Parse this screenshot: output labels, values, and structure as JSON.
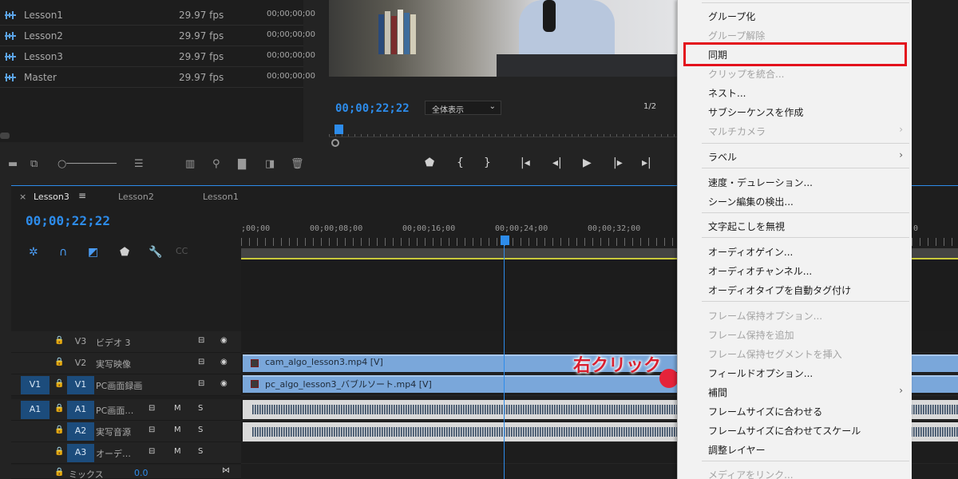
{
  "project": {
    "sequences": [
      {
        "name": "Lesson1",
        "fps": "29.97 fps",
        "tc": "00;00;00;00"
      },
      {
        "name": "Lesson2",
        "fps": "29.97 fps",
        "tc": "00;00;00;00"
      },
      {
        "name": "Lesson3",
        "fps": "29.97 fps",
        "tc": "00;00;00;00"
      },
      {
        "name": "Master",
        "fps": "29.97 fps",
        "tc": "00;00;00;00"
      }
    ]
  },
  "program": {
    "timecode": "00;00;22;22",
    "zoom": "全体表示",
    "resolution": "1/2"
  },
  "timeline": {
    "tab_close": "×",
    "tab_active": "Lesson3",
    "tab_menu": "≡",
    "tab_2": "Lesson2",
    "tab_1": "Lesson1",
    "timecode": "00;00;22;22",
    "ruler": [
      ";00;00",
      "00;00;08;00",
      "00;00;16;00",
      "00;00;24;00",
      "00;00;32;00",
      "0"
    ],
    "tracks": {
      "v3": {
        "target": "V3",
        "name": "ビデオ 3"
      },
      "v2": {
        "target": "V2",
        "name": "実写映像"
      },
      "v1": {
        "source": "V1",
        "target": "V1",
        "name": "PC画面録画"
      },
      "a1": {
        "source": "A1",
        "target": "A1",
        "name": "PC画面…"
      },
      "a2": {
        "target": "A2",
        "name": "実写音源"
      },
      "a3": {
        "target": "A3",
        "name": "オーデ…"
      },
      "mix": {
        "name": "ミックス",
        "value": "0.0"
      }
    },
    "mute_label": "M",
    "solo_label": "S",
    "clips": {
      "v2_clip": "cam_algo_lesson3.mp4 [V]",
      "v1_clip": "pc_algo_lesson3_バブルソート.mp4 [V]"
    }
  },
  "annotation": "右クリック",
  "context_menu": {
    "items_top": [
      {
        "label": "グループ化",
        "disabled": false
      },
      {
        "label": "グループ解除",
        "disabled": true
      },
      {
        "label": "同期",
        "disabled": false
      },
      {
        "label": "クリップを統合...",
        "disabled": true
      },
      {
        "label": "ネスト...",
        "disabled": false
      },
      {
        "label": "サブシーケンスを作成",
        "disabled": false
      },
      {
        "label": "マルチカメラ",
        "disabled": true
      }
    ],
    "label_item": "ラベル",
    "items_speed": [
      "速度・デュレーション...",
      "シーン編集の検出..."
    ],
    "transcribe": "文字起こしを無視",
    "items_audio": [
      "オーディオゲイン...",
      "オーディオチャンネル...",
      "オーディオタイプを自動タグ付け"
    ],
    "items_frame": [
      {
        "label": "フレーム保持オプション...",
        "disabled": true
      },
      {
        "label": "フレーム保持を追加",
        "disabled": true
      },
      {
        "label": "フレーム保持セグメントを挿入",
        "disabled": true
      },
      {
        "label": "フィールドオプション...",
        "disabled": false
      },
      {
        "label": "補間",
        "disabled": false
      },
      {
        "label": "フレームサイズに合わせる",
        "disabled": false
      },
      {
        "label": "フレームサイズに合わせてスケール",
        "disabled": false
      },
      {
        "label": "調整レイヤー",
        "disabled": false
      }
    ],
    "relink": "メディアをリンク..."
  },
  "colors": {
    "accent": "#2d8ceb",
    "highlight": "#e3101c",
    "clip_video": "#7aa7da"
  }
}
